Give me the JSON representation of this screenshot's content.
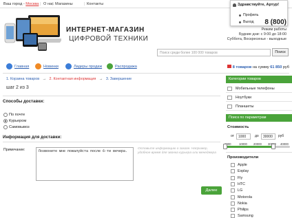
{
  "topbar": {
    "city_label": "Ваш город - ",
    "city_value": "Москва",
    "links": [
      "О нас",
      "Магазины",
      "Контакты"
    ]
  },
  "user_menu": {
    "greeting": "Здравствуйте, Артур!",
    "items": [
      "Профиль",
      "Выход"
    ]
  },
  "header": {
    "brand_line1": "ИНТЕРНЕТ-МАГАЗИН",
    "brand_line2": "ЦИФРОВОЙ ТЕХНИКИ",
    "phone": "8 (800)",
    "hours_title": "Режим работы",
    "hours_weekdays": "Будние дни: с 9:00 до 18:00",
    "hours_weekend": "Суббота, Воскресенье - выходные"
  },
  "search": {
    "placeholder": "Поиск среди более 100 000 товаров",
    "button": "Поиск"
  },
  "nav": {
    "items": [
      "Главная",
      "Новинки",
      "Лидеры продаж",
      "Распродажа"
    ],
    "icon_colors": [
      "#3b7dd8",
      "#f08a24",
      "#3b7dd8",
      "#4aa33a"
    ]
  },
  "cart": {
    "prefix": "",
    "count": "8 товаров",
    "middle": " на сумму ",
    "sum": "61 850",
    "currency": " руб"
  },
  "steps": {
    "s1": "1. Корзина товаров",
    "arrow": "→",
    "s2": "2. Контактная информация",
    "s3": "3. Завершение",
    "counter": "шаг 2 из 3"
  },
  "delivery": {
    "title": "Способы доставки:",
    "options": [
      "По почте",
      "Курьером",
      "Самовывоз"
    ],
    "selected": 1
  },
  "info": {
    "title": "Информация для доставки:",
    "note_label": "Примечание:",
    "note_value": "Позвоните мне пожалуйста после 6-ти вечера.",
    "hint": "Оставьте информацию о заказе. Например, удобное время для звонка курьера или менеджера"
  },
  "next_button": "Далее",
  "sidebar": {
    "categories_title": "Категории товаров",
    "categories": [
      "Мобильные телефоны",
      "Ноутбуки",
      "Планшеты"
    ],
    "params_title": "Поиск по параметрам",
    "price_title": "Стоимость",
    "price_from_label": "от",
    "price_from": "1000",
    "price_to_label": "до",
    "price_to": "30000",
    "price_currency": "руб",
    "slider_ticks": [
      "1000",
      "10000",
      "20000",
      "30000",
      "40000"
    ],
    "slider_range": [
      1000,
      40000
    ],
    "slider_values": [
      1000,
      30000
    ],
    "makers_title": "Производители",
    "makers": [
      "Apple",
      "Explay",
      "Fly",
      "HTC",
      "LG",
      "Motorola",
      "Nokia",
      "Philips",
      "Samsung"
    ]
  },
  "colors": {
    "accent_green": "#4aa33a",
    "link_blue": "#2a5db0",
    "red": "#d33333"
  }
}
